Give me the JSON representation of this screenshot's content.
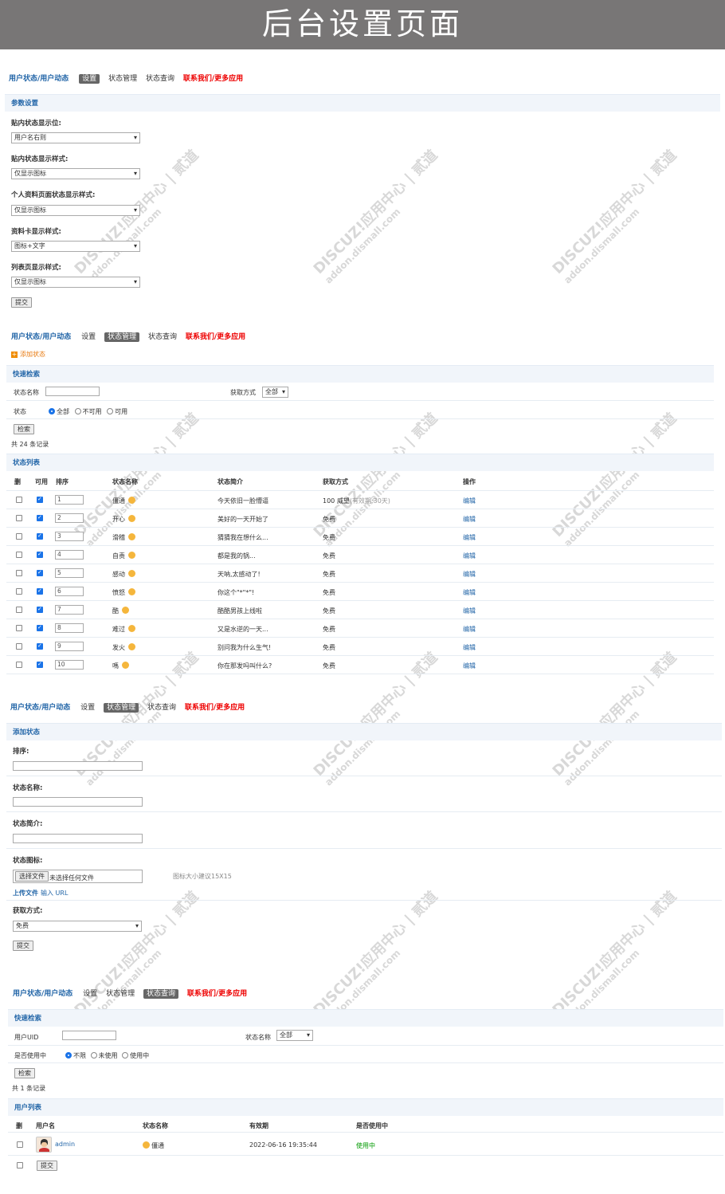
{
  "banner": {
    "title": "后台设置页面"
  },
  "nav": {
    "title": "用户状态/用户动态",
    "settings": "设置",
    "manage": "状态管理",
    "query": "状态查询",
    "contact": "联系我们/更多应用"
  },
  "watermark": {
    "line1": "DISCUZ!应用中心 | 贰道",
    "line2": "addon.dismall.com"
  },
  "params": {
    "header": "参数设置",
    "fields": [
      {
        "label": "贴内状态显示位:",
        "value": "用户名右则"
      },
      {
        "label": "贴内状态显示样式:",
        "value": "仅显示图标"
      },
      {
        "label": "个人资料页面状态显示样式:",
        "value": "仅显示图标"
      },
      {
        "label": "资料卡显示样式:",
        "value": "图标+文字"
      },
      {
        "label": "列表页显示样式:",
        "value": "仅显示图标"
      }
    ],
    "submit": "提交"
  },
  "manage": {
    "add_link": "添加状态",
    "search_header": "快速检索",
    "name_label": "状态名称",
    "method_label": "获取方式",
    "method_value": "全部",
    "status_label": "状态",
    "radio_all": "全部",
    "radio_disabled": "不可用",
    "radio_enabled": "可用",
    "search_btn": "检索",
    "total": "共 24 条记录",
    "list_header": "状态列表",
    "columns": [
      "删",
      "可用",
      "排序",
      "状态名称",
      "状态简介",
      "获取方式",
      "操作"
    ],
    "rows": [
      {
        "order": "1",
        "name": "僵通",
        "intro": "今天依旧一脸懵逼",
        "method": "100 威望",
        "validity": "(有效期:30天)",
        "action": "编辑"
      },
      {
        "order": "2",
        "name": "开心",
        "intro": "美好的一天开始了",
        "method": "免费",
        "validity": "",
        "action": "编辑"
      },
      {
        "order": "3",
        "name": "滑稽",
        "intro": "猜猜我在想什么...",
        "method": "免费",
        "validity": "",
        "action": "编辑"
      },
      {
        "order": "4",
        "name": "自责",
        "intro": "都是我的锅...",
        "method": "免费",
        "validity": "",
        "action": "编辑"
      },
      {
        "order": "5",
        "name": "感动",
        "intro": "天呐,太感动了!",
        "method": "免费",
        "validity": "",
        "action": "编辑"
      },
      {
        "order": "6",
        "name": "愤怒",
        "intro": "你这个\"*\"*\"!",
        "method": "免费",
        "validity": "",
        "action": "编辑"
      },
      {
        "order": "7",
        "name": "酷",
        "intro": "酷酷男孩上线啦",
        "method": "免费",
        "validity": "",
        "action": "编辑"
      },
      {
        "order": "8",
        "name": "难过",
        "intro": "又是水逆的一天...",
        "method": "免费",
        "validity": "",
        "action": "编辑"
      },
      {
        "order": "9",
        "name": "发火",
        "intro": "别问我为什么生气!",
        "method": "免费",
        "validity": "",
        "action": "编辑"
      },
      {
        "order": "10",
        "name": "嗎",
        "intro": "你在那发吗叫什么?",
        "method": "免费",
        "validity": "",
        "action": "编辑"
      }
    ]
  },
  "add": {
    "header": "添加状态",
    "order_label": "排序:",
    "name_label": "状态名称:",
    "intro_label": "状态简介:",
    "icon_label": "状态图标:",
    "file_btn": "选择文件",
    "file_none": "未选择任何文件",
    "icon_hint": "图标大小建议15X15",
    "upload_file": "上传文件",
    "input_url": "输入 URL",
    "method_label": "获取方式:",
    "method_value": "免费",
    "submit": "提交"
  },
  "query": {
    "search_header": "快速检索",
    "uid_label": "用户UID",
    "name_label": "状态名称",
    "name_value": "全部",
    "inuse_label": "是否使用中",
    "radio_all": "不限",
    "radio_unused": "未使用",
    "radio_used": "使用中",
    "search_btn": "检索",
    "total": "共 1 条记录",
    "list_header": "用户列表",
    "columns": [
      "删",
      "用户名",
      "状态名称",
      "有效期",
      "是否使用中"
    ],
    "rows": [
      {
        "user": "admin",
        "status": "僵通",
        "expiry": "2022-06-16 19:35:44",
        "inuse": "使用中"
      }
    ],
    "submit": "提交"
  },
  "colors": {
    "banner": "#787676",
    "header_bg": "#f1f5fa",
    "link": "#2366a8",
    "contact": "#ee0000",
    "inuse": "#009900"
  }
}
